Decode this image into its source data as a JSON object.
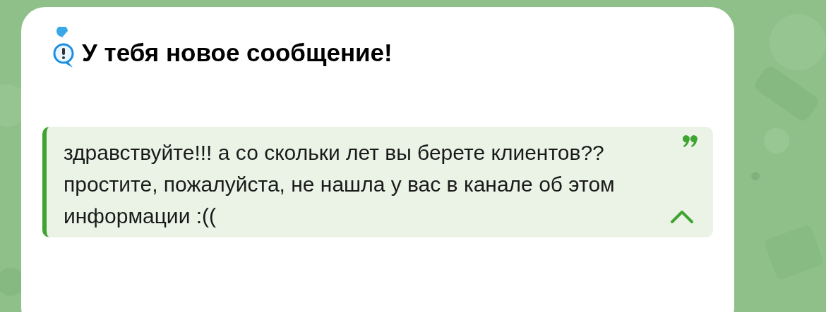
{
  "message": {
    "title": "У тебя новое сообщение!",
    "quote": {
      "expanded": true,
      "paragraphs": [
        "здравствуйте!!! а со скольки лет вы берете клиентов??",
        "простите, пожалуйста, не нашла у вас в канале об этом информации :(("
      ]
    }
  }
}
